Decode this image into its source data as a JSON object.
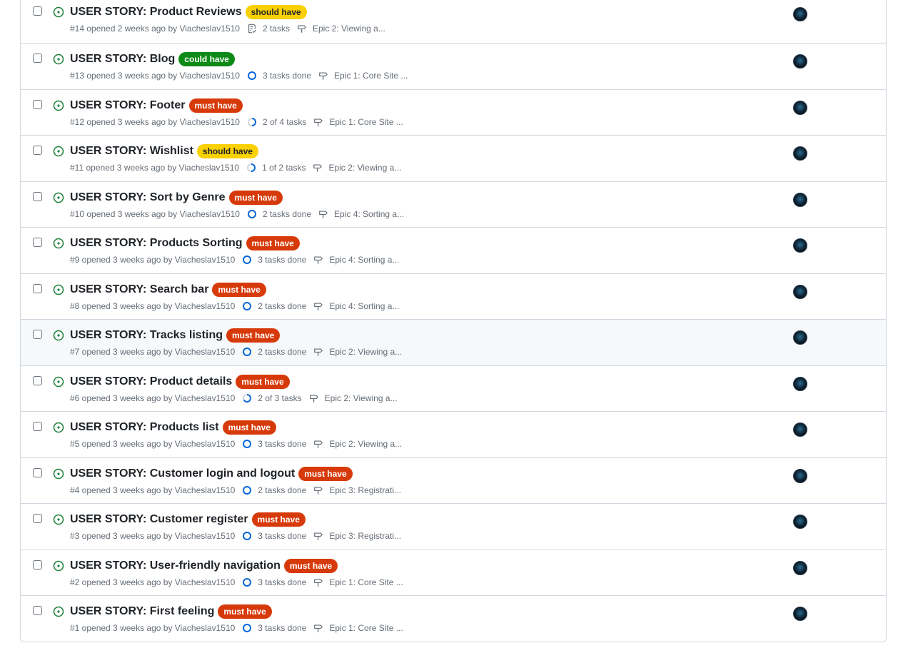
{
  "colors": {
    "open_icon": "#1a7f37",
    "must_have_bg": "#d73a0a",
    "must_have_fg": "#ffffff",
    "should_have_bg": "#f9d000",
    "should_have_fg": "#1f2328",
    "could_have_bg": "#0e8a16",
    "could_have_fg": "#ffffff",
    "progress": "#0969da"
  },
  "issues": [
    {
      "title": "USER STORY: Product Reviews",
      "label": "should have",
      "label_kind": "should",
      "meta": "#14 opened 2 weeks ago by Viacheslav1510",
      "tasks": "2 tasks",
      "tasks_icon": "checklist-icon",
      "tasks_progress": 0,
      "milestone": "Epic 2: Viewing a...",
      "hover": false
    },
    {
      "title": "USER STORY: Blog",
      "label": "could have",
      "label_kind": "could",
      "meta": "#13 opened 3 weeks ago by Viacheslav1510",
      "tasks": "3 tasks done",
      "tasks_icon": "progress-ring-icon",
      "tasks_progress": 1,
      "milestone": "Epic 1: Core Site ...",
      "hover": false
    },
    {
      "title": "USER STORY: Footer",
      "label": "must have",
      "label_kind": "must",
      "meta": "#12 opened 3 weeks ago by Viacheslav1510",
      "tasks": "2 of 4 tasks",
      "tasks_icon": "progress-ring-icon",
      "tasks_progress": 0.5,
      "milestone": "Epic 1: Core Site ...",
      "hover": false
    },
    {
      "title": "USER STORY: Wishlist",
      "label": "should have",
      "label_kind": "should",
      "meta": "#11 opened 3 weeks ago by Viacheslav1510",
      "tasks": "1 of 2 tasks",
      "tasks_icon": "progress-ring-icon",
      "tasks_progress": 0.5,
      "milestone": "Epic 2: Viewing a...",
      "hover": false
    },
    {
      "title": "USER STORY: Sort by Genre",
      "label": "must have",
      "label_kind": "must",
      "meta": "#10 opened 3 weeks ago by Viacheslav1510",
      "tasks": "2 tasks done",
      "tasks_icon": "progress-ring-icon",
      "tasks_progress": 1,
      "milestone": "Epic 4: Sorting a...",
      "hover": false
    },
    {
      "title": "USER STORY: Products Sorting",
      "label": "must have",
      "label_kind": "must",
      "meta": "#9 opened 3 weeks ago by Viacheslav1510",
      "tasks": "3 tasks done",
      "tasks_icon": "progress-ring-icon",
      "tasks_progress": 1,
      "milestone": "Epic 4: Sorting a...",
      "hover": false
    },
    {
      "title": "USER STORY: Search bar",
      "label": "must have",
      "label_kind": "must",
      "meta": "#8 opened 3 weeks ago by Viacheslav1510",
      "tasks": "2 tasks done",
      "tasks_icon": "progress-ring-icon",
      "tasks_progress": 1,
      "milestone": "Epic 4: Sorting a...",
      "hover": false
    },
    {
      "title": "USER STORY: Tracks listing",
      "label": "must have",
      "label_kind": "must",
      "meta": "#7 opened 3 weeks ago by Viacheslav1510",
      "tasks": "2 tasks done",
      "tasks_icon": "progress-ring-icon",
      "tasks_progress": 1,
      "milestone": "Epic 2: Viewing a...",
      "hover": true
    },
    {
      "title": "USER STORY: Product details",
      "label": "must have",
      "label_kind": "must",
      "meta": "#6 opened 3 weeks ago by Viacheslav1510",
      "tasks": "2 of 3 tasks",
      "tasks_icon": "progress-ring-icon",
      "tasks_progress": 0.67,
      "milestone": "Epic 2: Viewing a...",
      "hover": false
    },
    {
      "title": "USER STORY: Products list",
      "label": "must have",
      "label_kind": "must",
      "meta": "#5 opened 3 weeks ago by Viacheslav1510",
      "tasks": "3 tasks done",
      "tasks_icon": "progress-ring-icon",
      "tasks_progress": 1,
      "milestone": "Epic 2: Viewing a...",
      "hover": false
    },
    {
      "title": "USER STORY: Customer login and logout",
      "label": "must have",
      "label_kind": "must",
      "meta": "#4 opened 3 weeks ago by Viacheslav1510",
      "tasks": "2 tasks done",
      "tasks_icon": "progress-ring-icon",
      "tasks_progress": 1,
      "milestone": "Epic 3: Registrati...",
      "hover": false
    },
    {
      "title": "USER STORY: Customer register",
      "label": "must have",
      "label_kind": "must",
      "meta": "#3 opened 3 weeks ago by Viacheslav1510",
      "tasks": "3 tasks done",
      "tasks_icon": "progress-ring-icon",
      "tasks_progress": 1,
      "milestone": "Epic 3: Registrati...",
      "hover": false
    },
    {
      "title": "USER STORY: User-friendly navigation",
      "label": "must have",
      "label_kind": "must",
      "meta": "#2 opened 3 weeks ago by Viacheslav1510",
      "tasks": "3 tasks done",
      "tasks_icon": "progress-ring-icon",
      "tasks_progress": 1,
      "milestone": "Epic 1: Core Site ...",
      "hover": false
    },
    {
      "title": "USER STORY: First feeling",
      "label": "must have",
      "label_kind": "must",
      "meta": "#1 opened 3 weeks ago by Viacheslav1510",
      "tasks": "3 tasks done",
      "tasks_icon": "progress-ring-icon",
      "tasks_progress": 1,
      "milestone": "Epic 1: Core Site ...",
      "hover": false
    }
  ]
}
